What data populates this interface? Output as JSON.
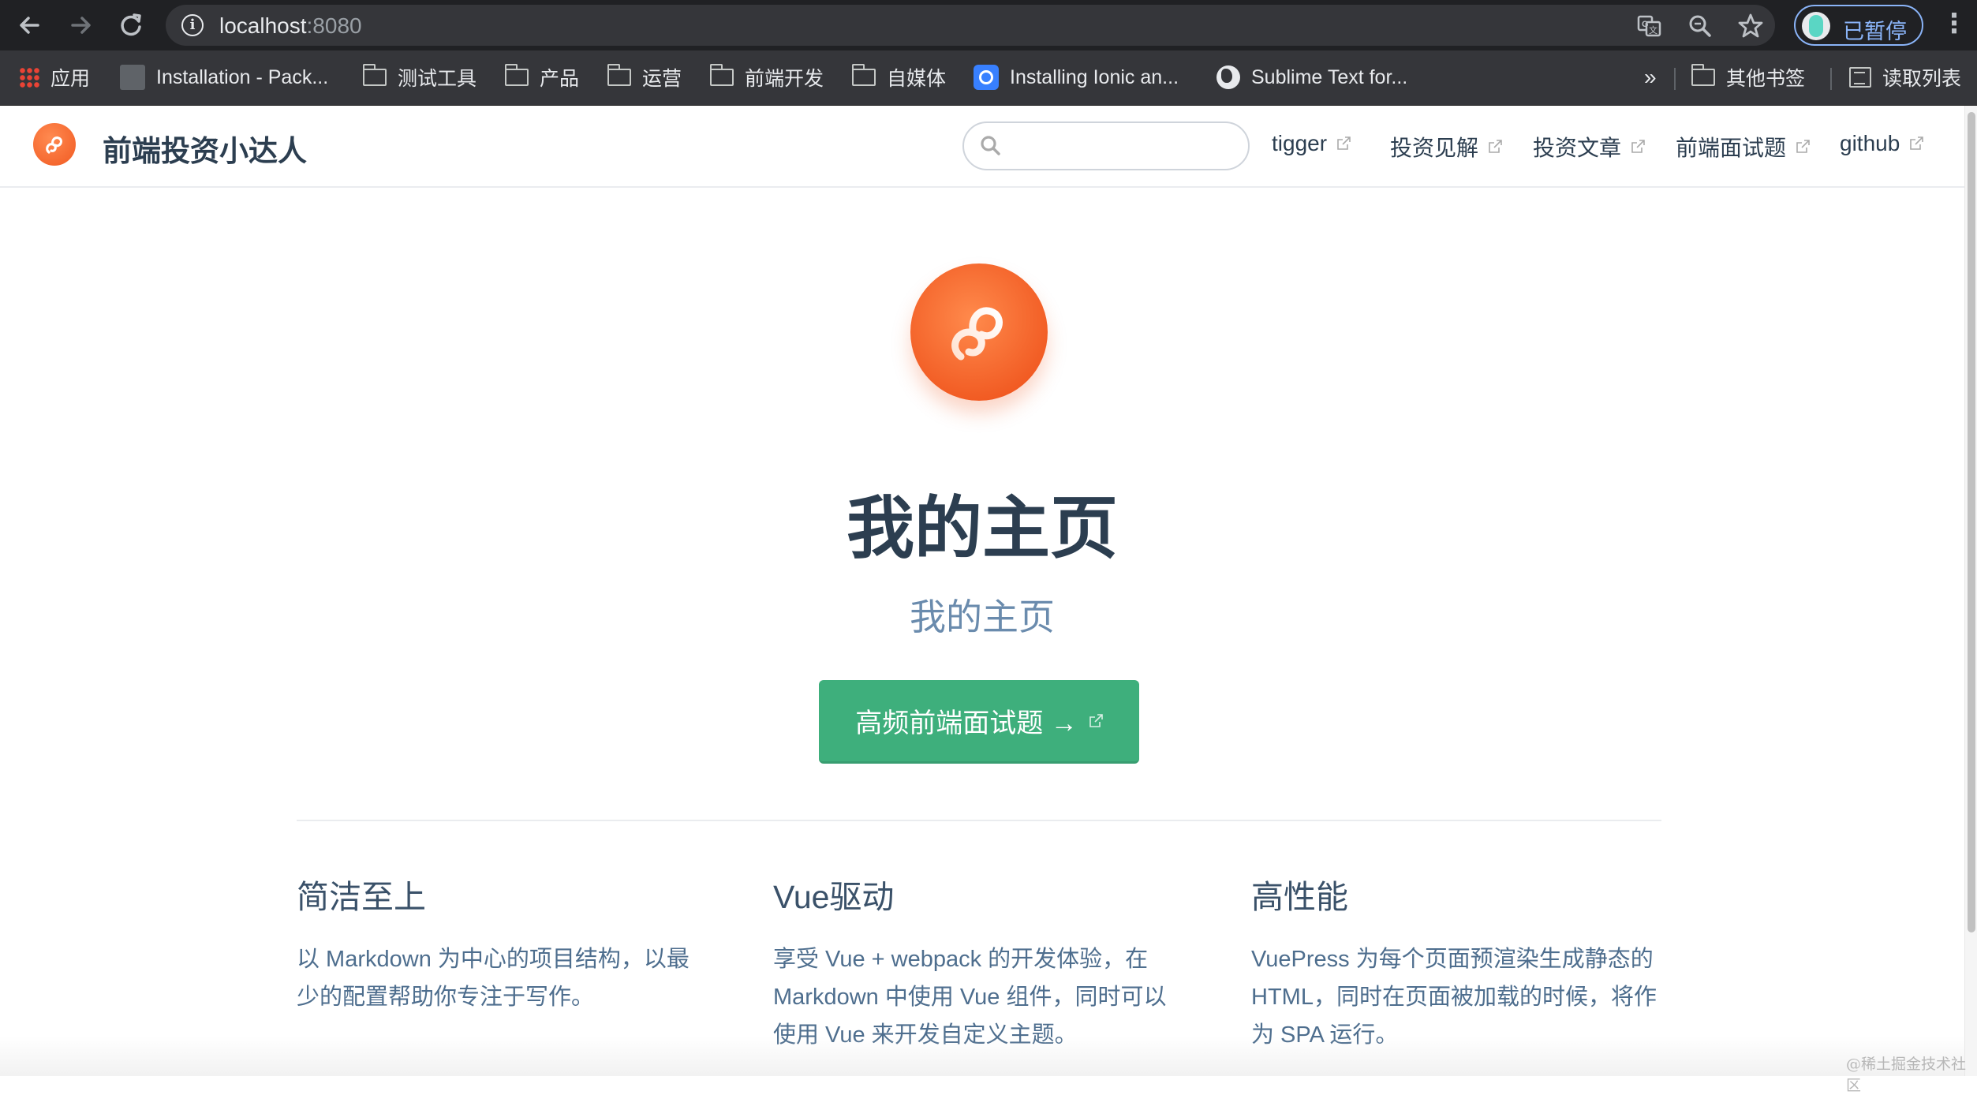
{
  "browser": {
    "url_host": "localhost",
    "url_port": ":8080",
    "profile_label": "已暂停",
    "icons": {
      "back": "arrow-left-icon",
      "forward": "arrow-right-icon",
      "reload": "reload-icon",
      "site_info": "info-icon",
      "translate": "translate-icon",
      "zoom": "zoom-icon",
      "bookmark": "star-icon",
      "menu": "kebab-menu-icon"
    }
  },
  "bookmarks": {
    "items": [
      {
        "label": "应用",
        "icon": "apps-grid-icon"
      },
      {
        "label": "Installation - Pack...",
        "icon": "page-icon"
      },
      {
        "label": "测试工具",
        "icon": "folder-icon"
      },
      {
        "label": "产品",
        "icon": "folder-icon"
      },
      {
        "label": "运营",
        "icon": "folder-icon"
      },
      {
        "label": "前端开发",
        "icon": "folder-icon"
      },
      {
        "label": "自媒体",
        "icon": "folder-icon"
      },
      {
        "label": "Installing Ionic an...",
        "icon": "ionic-icon"
      },
      {
        "label": "Sublime Text for...",
        "icon": "globe-icon"
      }
    ],
    "more": "»",
    "other_bookmarks": "其他书签",
    "reading_list": "读取列表"
  },
  "site": {
    "title": "前端投资小达人",
    "search_placeholder": "",
    "nav": [
      {
        "label": "tigger"
      },
      {
        "label": "投资见解"
      },
      {
        "label": "投资文章"
      },
      {
        "label": "前端面试题"
      },
      {
        "label": "github"
      }
    ]
  },
  "hero": {
    "title": "我的主页",
    "description": "我的主页",
    "action_label": "高频前端面试题 →"
  },
  "features": [
    {
      "title": "简洁至上",
      "details": "以 Markdown 为中心的项目结构，以最少的配置帮助你专注于写作。"
    },
    {
      "title": "Vue驱动",
      "details": "享受 Vue + webpack 的开发体验，在 Markdown 中使用 Vue 组件，同时可以使用 Vue 来开发自定义主题。"
    },
    {
      "title": "高性能",
      "details": "VuePress 为每个页面预渲染生成静态的 HTML，同时在页面被加载的时候，将作为 SPA 运行。"
    }
  ],
  "watermark": "@稀土掘金技术社区",
  "colors": {
    "accent": "#3eaf7c",
    "logo": "#f15a22",
    "text": "#2c3e50",
    "description": "#6a8bad"
  }
}
